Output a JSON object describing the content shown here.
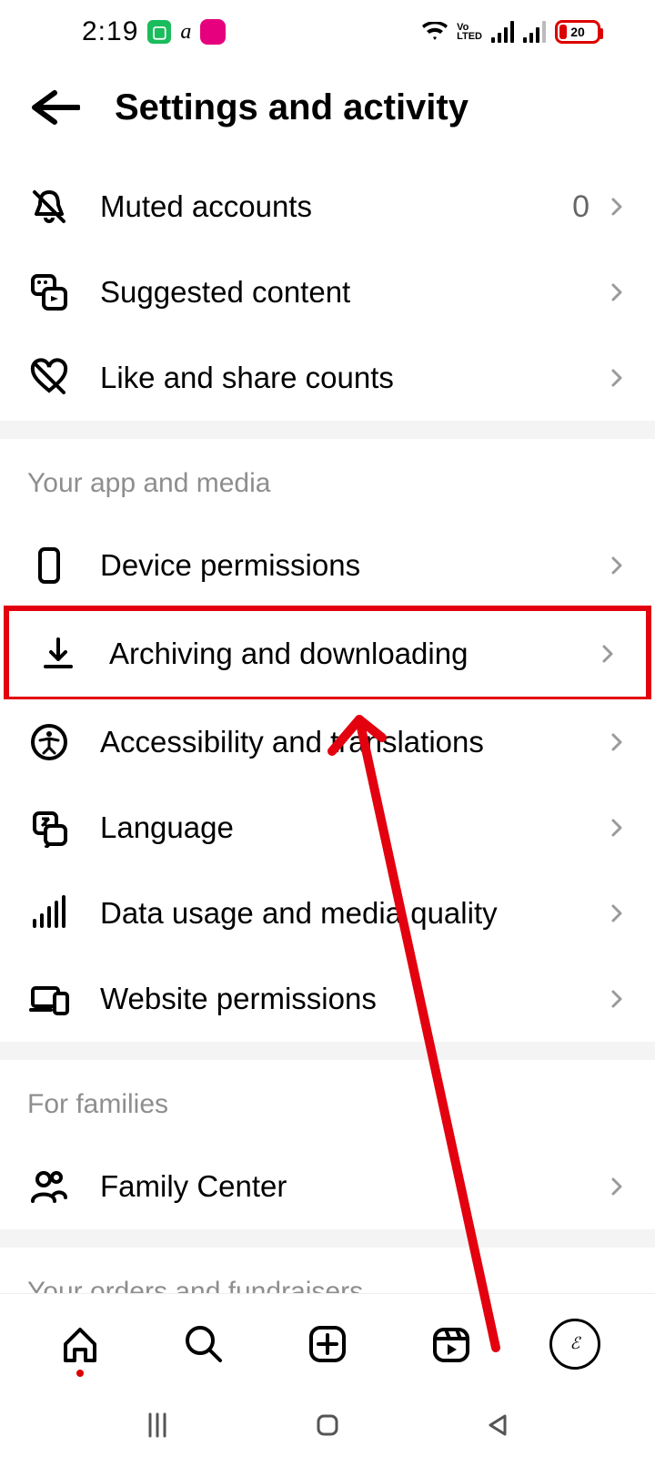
{
  "status": {
    "time": "2:19",
    "battery_pct": "20",
    "carrier_label": "Vo\nLTED"
  },
  "header": {
    "title": "Settings and activity"
  },
  "rows": {
    "muted": {
      "label": "Muted accounts",
      "value": "0"
    },
    "suggested": {
      "label": "Suggested content"
    },
    "likes": {
      "label": "Like and share counts"
    },
    "device": {
      "label": "Device permissions"
    },
    "archive": {
      "label": "Archiving and downloading"
    },
    "access": {
      "label": "Accessibility and translations"
    },
    "language": {
      "label": "Language"
    },
    "datausage": {
      "label": "Data usage and media quality"
    },
    "website": {
      "label": "Website permissions"
    },
    "family": {
      "label": "Family Center"
    }
  },
  "sections": {
    "app_media": "Your app and media",
    "families": "For families",
    "orders": "Your orders and fundraisers"
  },
  "annotation": {
    "highlighted_row": "archive"
  }
}
